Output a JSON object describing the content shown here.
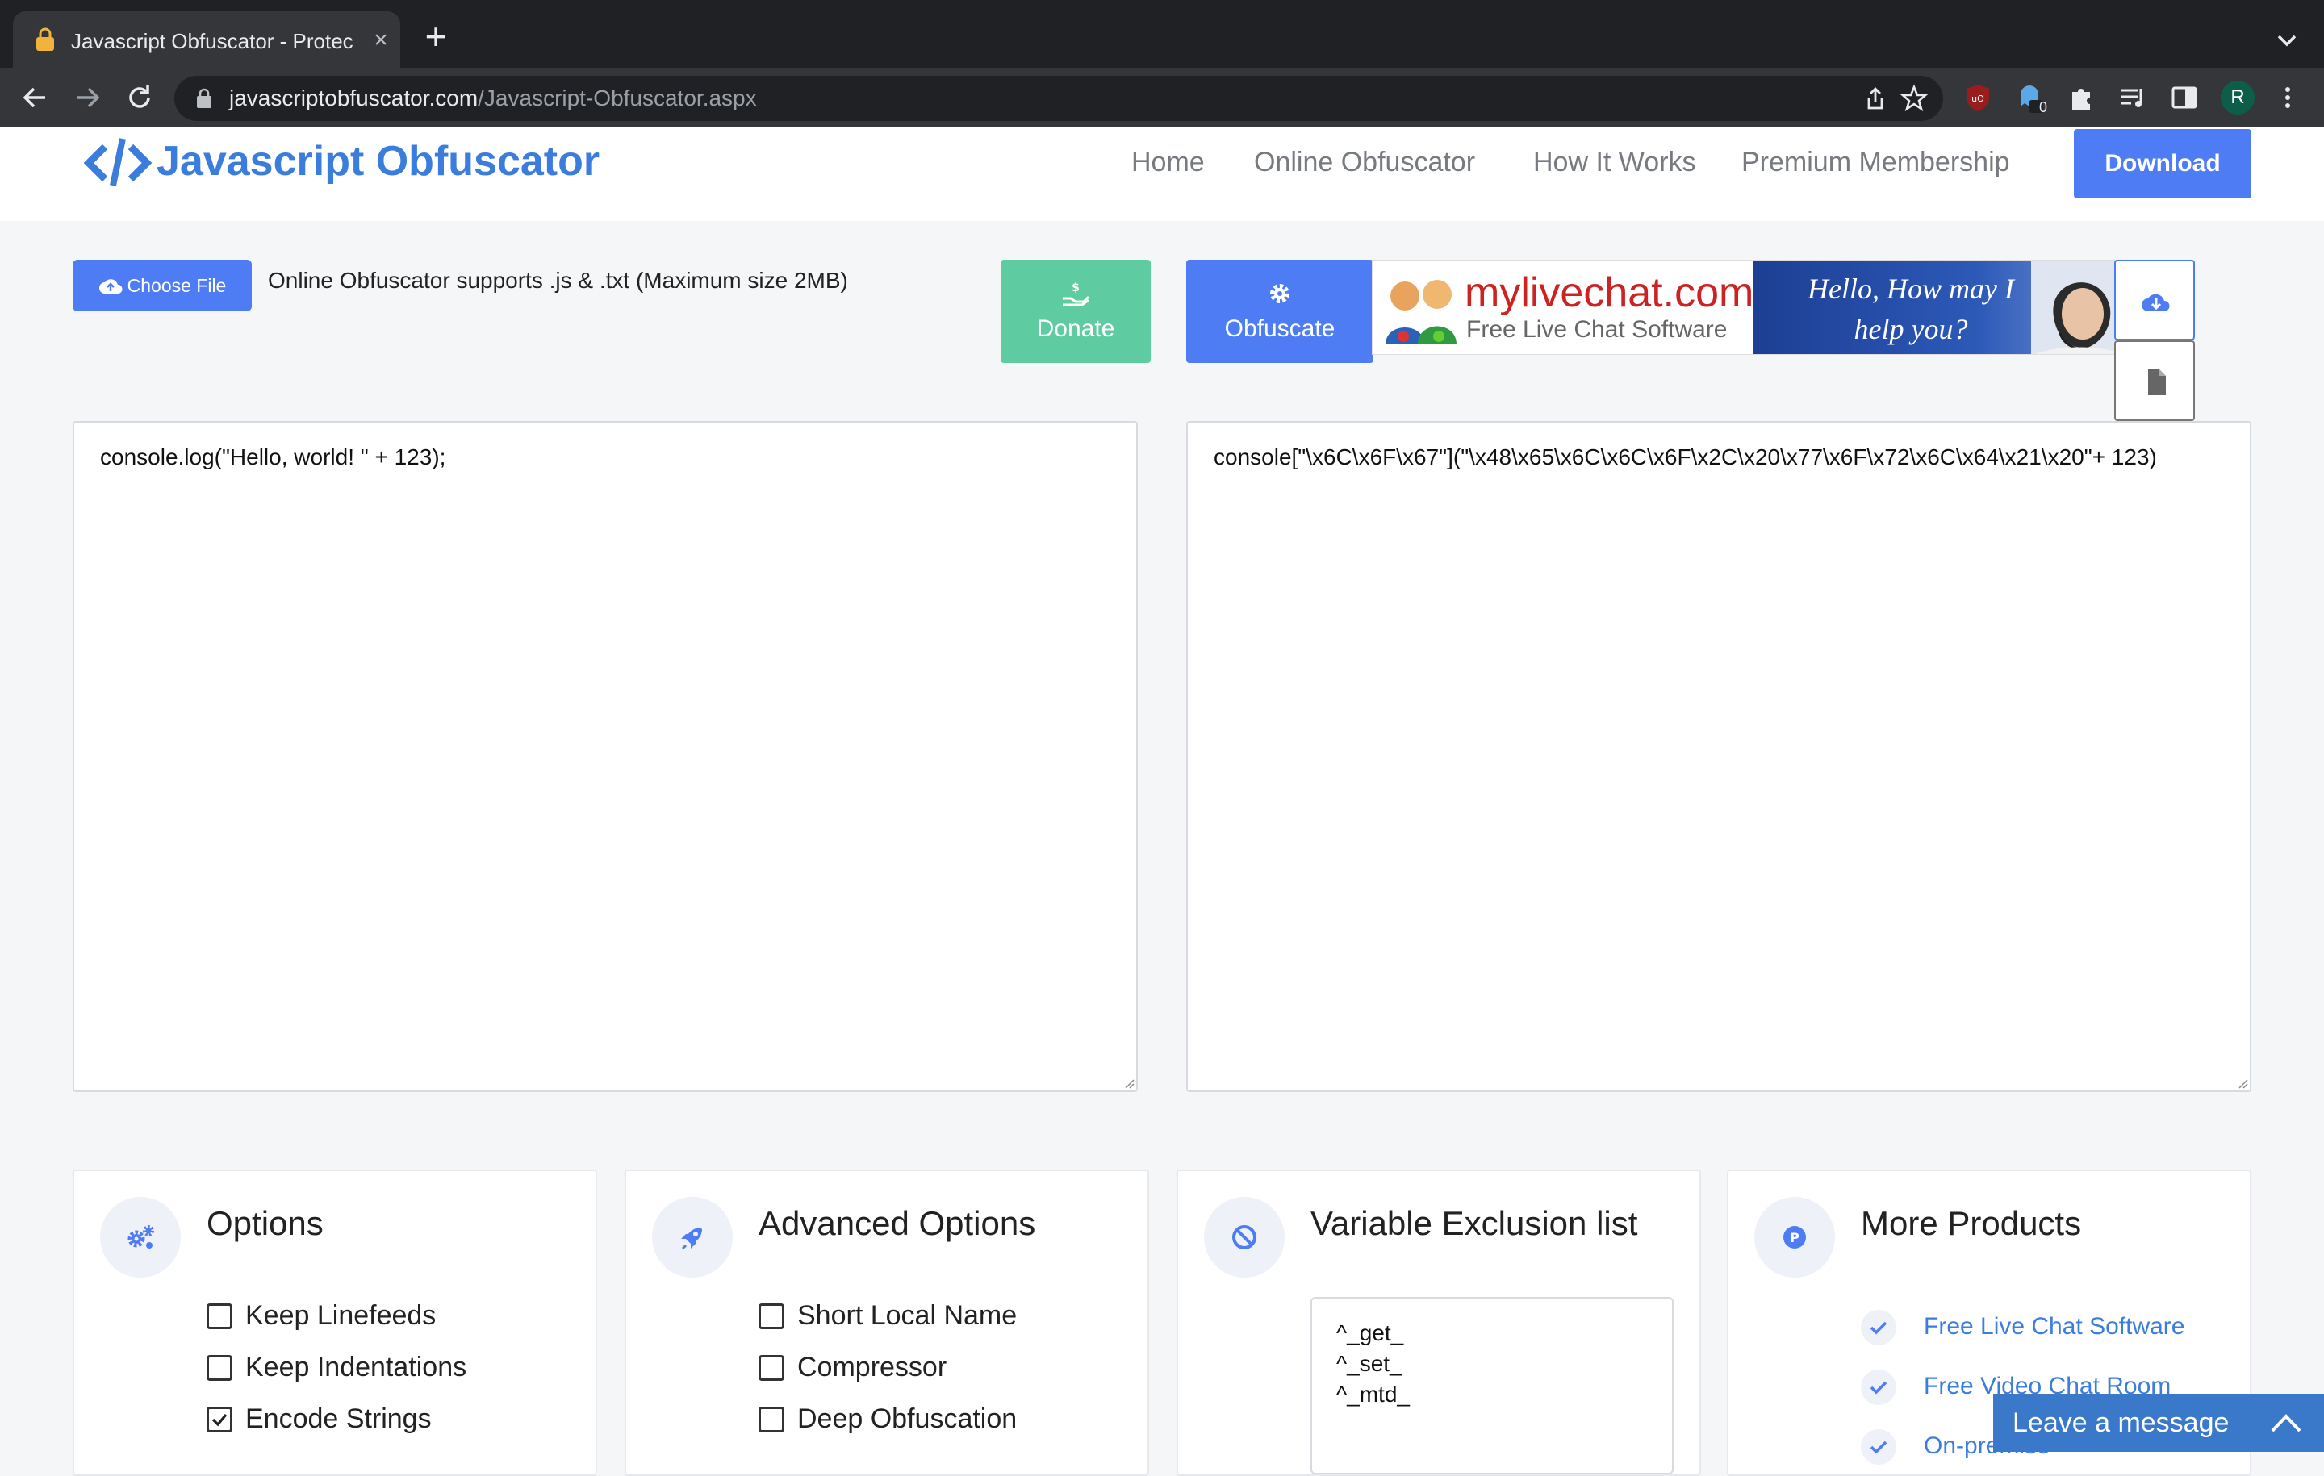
{
  "browser": {
    "tab_title": "Javascript Obfuscator - Protec",
    "tab_close": "×",
    "new_tab": "+",
    "url_host": "javascriptobfuscator.com",
    "url_path": "/Javascript-Obfuscator.aspx",
    "profile_initial": "R",
    "extension_badge": "0"
  },
  "site": {
    "logo_text": "Javascript Obfuscator",
    "nav": {
      "home": "Home",
      "online": "Online Obfuscator",
      "how": "How It Works",
      "premium": "Premium Membership"
    },
    "download_label": "Download"
  },
  "toolbar": {
    "choose_file_label": "Choose File",
    "support_text": "Online Obfuscator supports .js & .txt (Maximum size 2MB)",
    "donate_label": "Donate",
    "obfuscate_label": "Obfuscate"
  },
  "ad": {
    "brand": "mylivechat.com",
    "sub": "Free Live Chat Software",
    "hello_line1": "Hello, How may I",
    "hello_line2": "help you?"
  },
  "editor": {
    "input": "console.log(\"Hello, world! \" + 123);",
    "output": "console[\"\\x6C\\x6F\\x67\"](\"\\x48\\x65\\x6C\\x6C\\x6F\\x2C\\x20\\x77\\x6F\\x72\\x6C\\x64\\x21\\x20\"+ 123)"
  },
  "options": {
    "title": "Options",
    "items": [
      {
        "label": "Keep Linefeeds",
        "checked": false
      },
      {
        "label": "Keep Indentations",
        "checked": false
      },
      {
        "label": "Encode Strings",
        "checked": true
      }
    ]
  },
  "advanced": {
    "title": "Advanced Options",
    "items": [
      {
        "label": "Short Local Name",
        "checked": false
      },
      {
        "label": "Compressor",
        "checked": false
      },
      {
        "label": "Deep Obfuscation",
        "checked": false
      }
    ]
  },
  "exclusion": {
    "title": "Variable Exclusion list",
    "lines": [
      "^_get_",
      "^_set_",
      "^_mtd_"
    ]
  },
  "products": {
    "title": "More Products",
    "links": [
      "Free Live Chat Software",
      "Free Video Chat Room",
      "On-premise"
    ]
  },
  "chat": {
    "label": "Leave a message"
  },
  "colors": {
    "accent": "#4d7cf4",
    "donate": "#5ecba1",
    "logo": "#3b7ddd",
    "chrome_dark": "#202124"
  }
}
